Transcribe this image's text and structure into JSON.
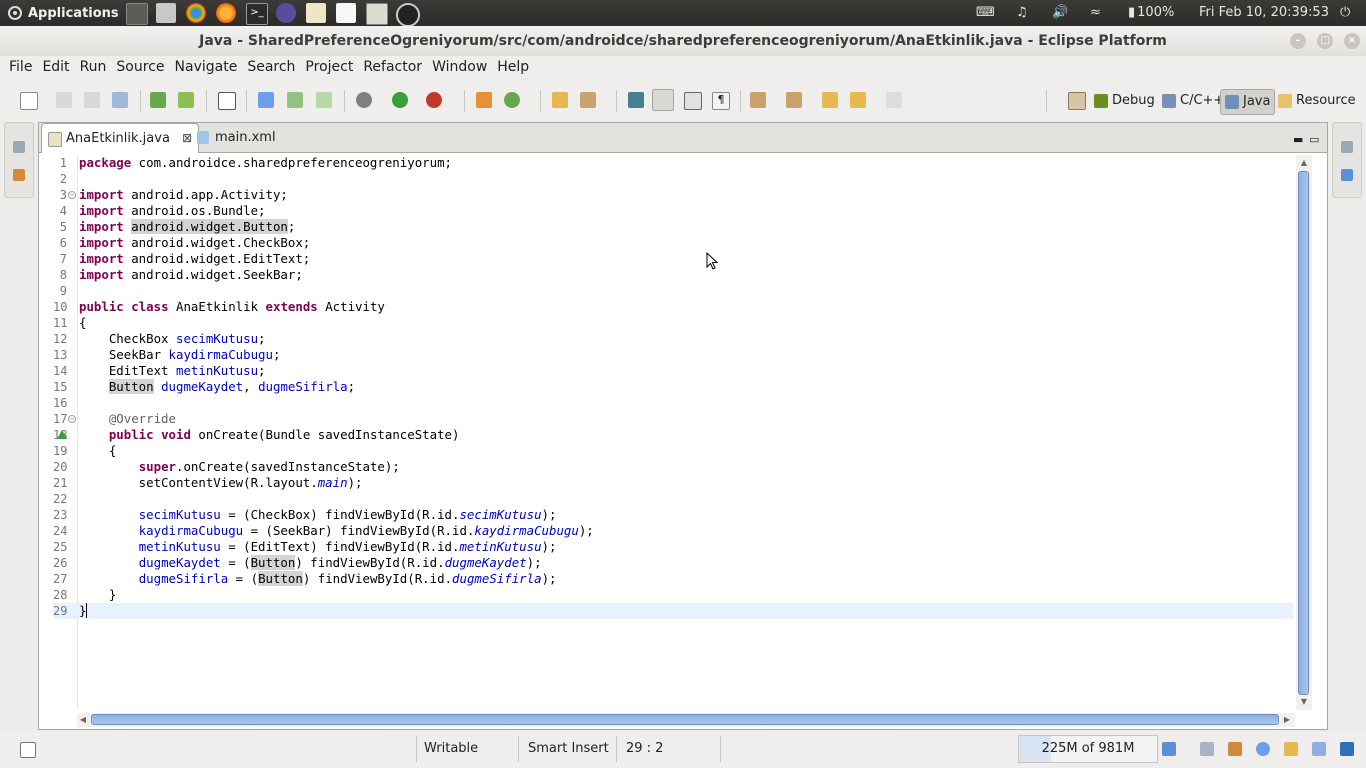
{
  "system_panel": {
    "applications_label": "Applications",
    "battery": "100%",
    "clock": "Fri Feb 10, 20:39:53"
  },
  "window": {
    "title": "Java - SharedPreferenceOgreniyorum/src/com/androidce/sharedpreferenceogreniyorum/AnaEtkinlik.java - Eclipse Platform"
  },
  "menu": [
    "File",
    "Edit",
    "Run",
    "Source",
    "Navigate",
    "Search",
    "Project",
    "Refactor",
    "Window",
    "Help"
  ],
  "perspectives": {
    "debug": "Debug",
    "cpp": "C/C++",
    "java": "Java",
    "resource": "Resource"
  },
  "tabs": [
    {
      "label": "AnaEtkinlik.java",
      "active": true
    },
    {
      "label": "main.xml",
      "active": false
    }
  ],
  "code_lines": [
    {
      "n": "1",
      "t": "package com.androidce.sharedpreferenceogreniyorum;"
    },
    {
      "n": "2",
      "t": ""
    },
    {
      "n": "3",
      "t": "import android.app.Activity;"
    },
    {
      "n": "4",
      "t": "import android.os.Bundle;"
    },
    {
      "n": "5",
      "t": "import android.widget.Button;"
    },
    {
      "n": "6",
      "t": "import android.widget.CheckBox;"
    },
    {
      "n": "7",
      "t": "import android.widget.EditText;"
    },
    {
      "n": "8",
      "t": "import android.widget.SeekBar;"
    },
    {
      "n": "9",
      "t": ""
    },
    {
      "n": "10",
      "t": "public class AnaEtkinlik extends Activity"
    },
    {
      "n": "11",
      "t": "{"
    },
    {
      "n": "12",
      "t": "    CheckBox secimKutusu;"
    },
    {
      "n": "13",
      "t": "    SeekBar kaydirmaCubugu;"
    },
    {
      "n": "14",
      "t": "    EditText metinKutusu;"
    },
    {
      "n": "15",
      "t": "    Button dugmeKaydet, dugmeSifirla;"
    },
    {
      "n": "16",
      "t": ""
    },
    {
      "n": "17",
      "t": "    @Override"
    },
    {
      "n": "18",
      "t": "    public void onCreate(Bundle savedInstanceState)"
    },
    {
      "n": "19",
      "t": "    {"
    },
    {
      "n": "20",
      "t": "        super.onCreate(savedInstanceState);"
    },
    {
      "n": "21",
      "t": "        setContentView(R.layout.main);"
    },
    {
      "n": "22",
      "t": ""
    },
    {
      "n": "23",
      "t": "        secimKutusu = (CheckBox) findViewById(R.id.secimKutusu);"
    },
    {
      "n": "24",
      "t": "        kaydirmaCubugu = (SeekBar) findViewById(R.id.kaydirmaCubugu);"
    },
    {
      "n": "25",
      "t": "        metinKutusu = (EditText) findViewById(R.id.metinKutusu);"
    },
    {
      "n": "26",
      "t": "        dugmeKaydet = (Button) findViewById(R.id.dugmeKaydet);"
    },
    {
      "n": "27",
      "t": "        dugmeSifirla = (Button) findViewById(R.id.dugmeSifirla);"
    },
    {
      "n": "28",
      "t": "    }"
    },
    {
      "n": "29",
      "t": "}"
    }
  ],
  "status": {
    "writable": "Writable",
    "insert_mode": "Smart Insert",
    "position": "29 : 2",
    "heap": "225M of 981M"
  },
  "colors": {
    "keyword": "#7f0055",
    "field": "#0000c0",
    "annotation": "#646464",
    "current_line": "#e8f2fe"
  }
}
